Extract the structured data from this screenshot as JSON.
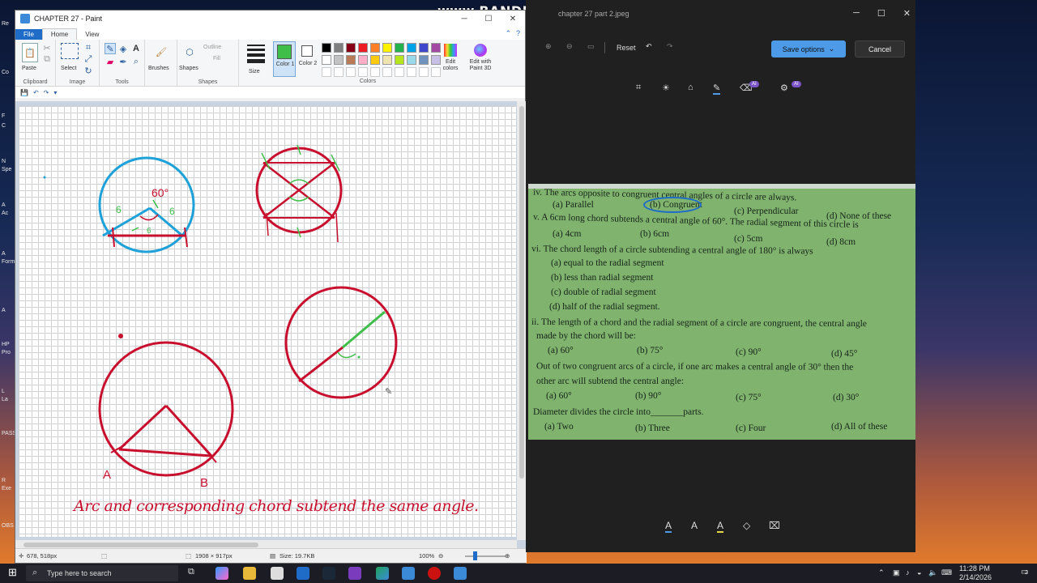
{
  "desktop": {
    "icon_labels": [
      "Re",
      "Co",
      "F",
      "C",
      "N",
      "Spe",
      "A",
      "Ac",
      "A",
      "Form",
      "A",
      "HP",
      "Pro",
      "L",
      "La",
      "PASS",
      "R",
      "Exe",
      "OBS"
    ]
  },
  "bandicam": {
    "text": "www.BANDICAM.com"
  },
  "paint": {
    "title": "CHAPTER 27 - Paint",
    "tabs": [
      "File",
      "Home",
      "View"
    ],
    "ribbon": {
      "clipboard": {
        "paste": "Paste",
        "label": "Clipboard"
      },
      "image": {
        "select": "Select",
        "label": "Image"
      },
      "tools": {
        "label": "Tools"
      },
      "brushes": "Brushes",
      "shapes": {
        "shapes": "Shapes",
        "outline": "Outline",
        "fill": "Fill",
        "label": "Shapes"
      },
      "size": "Size",
      "color1": "Color 1",
      "color2": "Color 2",
      "colors_label": "Colors",
      "edit_colors": "Edit colors",
      "edit_paint3d": "Edit with Paint 3D",
      "palette": [
        "#000000",
        "#7f7f7f",
        "#880015",
        "#ed1c24",
        "#ff7f27",
        "#fff200",
        "#22b14c",
        "#00a2e8",
        "#3f48cc",
        "#a349a4",
        "#ffffff",
        "#c3c3c3",
        "#b97a57",
        "#ffaec9",
        "#ffc90e",
        "#efe4b0",
        "#b5e61d",
        "#99d9ea",
        "#7092be",
        "#c8bfe7"
      ],
      "color1_value": "#3fbf4a",
      "color2_value": "#ffffff"
    },
    "canvas": {
      "angle_text": "60°",
      "label_6a": "6",
      "label_6b": "6",
      "label_6c": "6",
      "label_a": "A",
      "label_b": "B",
      "caption": "Arc and corresponding chord subtend the same angle."
    },
    "status": {
      "cursor": "678, 518px",
      "dimensions": "1908 × 917px",
      "size": "Size: 19.7KB",
      "zoom": "100%"
    }
  },
  "photos": {
    "file_name": "chapter 27 part 2.jpeg",
    "reset": "Reset",
    "save_options": "Save options",
    "cancel": "Cancel",
    "ai_badge": "AI",
    "questions": [
      "iv. The arcs opposite to congruent central angles of a circle are always.",
      "(a) Parallel",
      "(b) Congruent",
      "(c) Perpendicular",
      "(d) None of these",
      "v.  A 6cm long chord subtends a central angle of 60°. The radial segment of this circle is",
      "(a) 4cm",
      "(b) 6cm",
      "(c) 5cm",
      "(d) 8cm",
      "vi. The chord length of a circle subtending a central angle of 180° is always",
      "(a) equal to the radial segment",
      "(b) less than radial segment",
      "(c) double of radial segment",
      "(d) half of the radial segment.",
      "ii. The length of a chord and the radial segment of a circle are congruent, the  central angle",
      "made by the chord will be:",
      "(a) 60°",
      "(b) 75°",
      "(c) 90°",
      "(d) 45°",
      "Out of two congruent arcs of a circle, if one arc makes a central angle of 30° then the",
      "other arc will subtend the central angle:",
      "(a) 60°",
      "(b) 90°",
      "(c) 75°",
      "(d) 30°",
      "Diameter divides the circle into_______parts.",
      "(a) Two",
      "(b) Three",
      "(c) Four",
      "(d) All of these"
    ]
  },
  "taskbar": {
    "search_placeholder": "Type here to search",
    "time": "11:28 PM",
    "date": "2/14/2026",
    "notification_count": "2"
  }
}
